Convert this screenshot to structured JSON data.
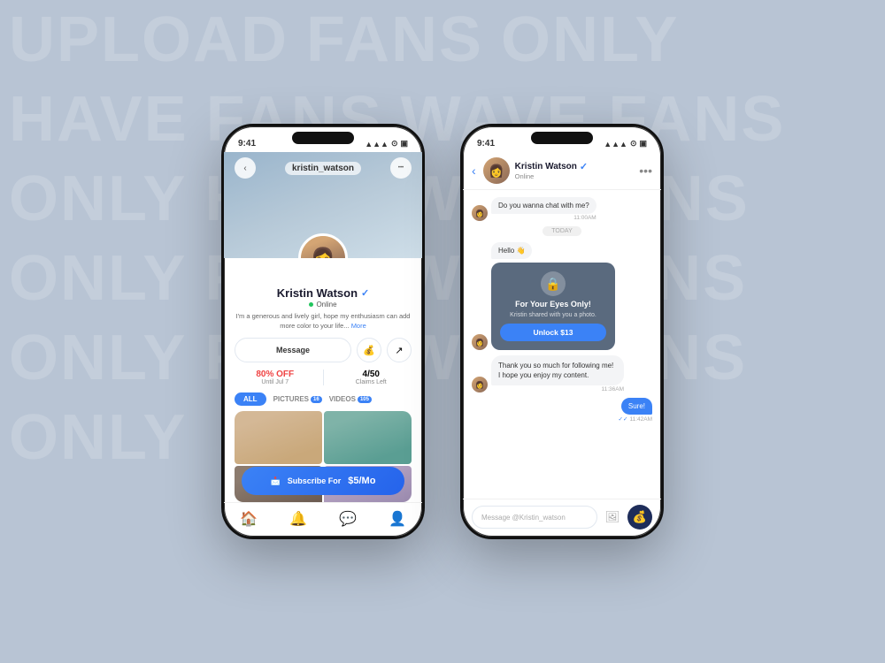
{
  "background": {
    "words": [
      "UPLOAD",
      "FANS",
      "ONLY",
      "HAVE",
      "FANS",
      "WAVE",
      "FANS",
      "ONLY",
      "HAVE",
      "WAVE",
      "ANS",
      "ONLY",
      "FANS",
      "WAVE",
      "ANS",
      "ONLY",
      "FANS"
    ]
  },
  "phone1": {
    "statusBar": {
      "time": "9:41",
      "signal": "●●●",
      "wifi": "wifi",
      "battery": "battery"
    },
    "header": {
      "backLabel": "‹",
      "username": "kristin_watson",
      "moreLabel": "•••"
    },
    "profile": {
      "name": "Kristin Watson",
      "verified": "✓",
      "status": "Online",
      "bio": "I'm a generous and lively girl, hope my enthusiasm can add more color to your life...",
      "bioMore": "More"
    },
    "actions": {
      "message": "Message",
      "tip": "💰",
      "share": "↗"
    },
    "promo": {
      "discount": "80% OFF",
      "discountSub": "Until Jul 7",
      "claims": "4/50",
      "claimsSub": "Claims Left"
    },
    "tabs": {
      "all": "ALL",
      "pictures": "PICTURES",
      "picturesBadge": "16",
      "videos": "VIDEOS",
      "videosBadge": "105"
    },
    "subscribe": {
      "label": "Subscribe For",
      "price": "$5/Mo"
    },
    "bottomNav": [
      "🏠",
      "🔔",
      "💬",
      "👤"
    ]
  },
  "phone2": {
    "statusBar": {
      "time": "9:41",
      "signal": "●●●",
      "wifi": "wifi",
      "battery": "battery"
    },
    "header": {
      "backLabel": "‹",
      "userName": "Kristin Watson",
      "verified": "✓",
      "status": "Online",
      "moreLabel": "•••"
    },
    "messages": [
      {
        "type": "received",
        "text": "Do you wanna chat with me?",
        "time": "11:00AM"
      },
      {
        "type": "divider",
        "text": "TODAY"
      },
      {
        "type": "received",
        "text": "Hello 👋"
      },
      {
        "type": "media-card",
        "title": "For Your Eyes Only!",
        "subtitle": "Kristin shared with you a photo.",
        "unlockLabel": "Unlock  $13"
      },
      {
        "type": "received",
        "text": "Thank you so much for following me! I hope you enjoy my content.",
        "time": "11:36AM"
      },
      {
        "type": "sent",
        "text": "Sure!",
        "time": "11:42AM"
      }
    ],
    "input": {
      "placeholder": "Message @Kristin_watson"
    }
  }
}
